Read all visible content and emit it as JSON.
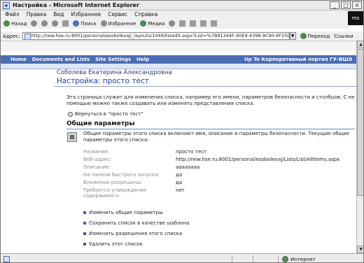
{
  "window": {
    "title": "Настройка - Microsoft Internet Explorer",
    "controls": [
      "_",
      "□",
      "×"
    ],
    "logo_text": "ms"
  },
  "menu": [
    "Файл",
    "Правка",
    "Вид",
    "Избранное",
    "Сервис",
    "Справка"
  ],
  "toolbar": {
    "back": "Назад",
    "search": "Поиск",
    "favorites": "Избранное",
    "media": "Медиа"
  },
  "address": {
    "label": "Адрес:",
    "value": "http://new.hse.ru:8001/personal/esobolevaj/_layouts/1049/listedit.aspx?List=%7B91344F-90E9-4398-9C90-6F25DC...",
    "go": "Переход",
    "links": "Ссылки"
  },
  "sharepoint": {
    "nav": [
      "Home",
      "Documents and Lists",
      "Site Settings",
      "Help"
    ],
    "nav_right": "Up To Корпоративный портал ГУ-ВШЭ",
    "user": "Соболева Екатерина Александровна",
    "page_title": "Настройка: просто тест",
    "description": "Эта страница служит для изменения списка, например его имени, параметров безопасности и столбцов. С ее помощью можно также создавать или изменять представления списка.",
    "back_link": "Вернуться в \"просто тест\"",
    "section_title": "Общие параметры",
    "section_desc": "Общие параметры этого списка включают имя, описание и параметры безопасности. Текущие общие параметры этого списка:",
    "properties": [
      {
        "label": "Название:",
        "value": "просто тест"
      },
      {
        "label": "Веб-адрес:",
        "value": "http://new.hse.ru:8001/personal/esobolevaj/Lists/List/AllItems.aspx"
      },
      {
        "label": "Описание:",
        "value": "аааааааа"
      },
      {
        "label": "На панели быстрого запуска:",
        "value": "да"
      },
      {
        "label": "Вложения разрешены:",
        "value": "да"
      },
      {
        "label": "Требуется утверждение содержимого:",
        "value": "нет"
      }
    ],
    "actions": [
      "Изменить общие параметры",
      "Сохранить список в качестве шаблона",
      "Изменить разрешения этого списка",
      "Удалить этот список"
    ]
  },
  "status": {
    "zone": "Интернет"
  }
}
